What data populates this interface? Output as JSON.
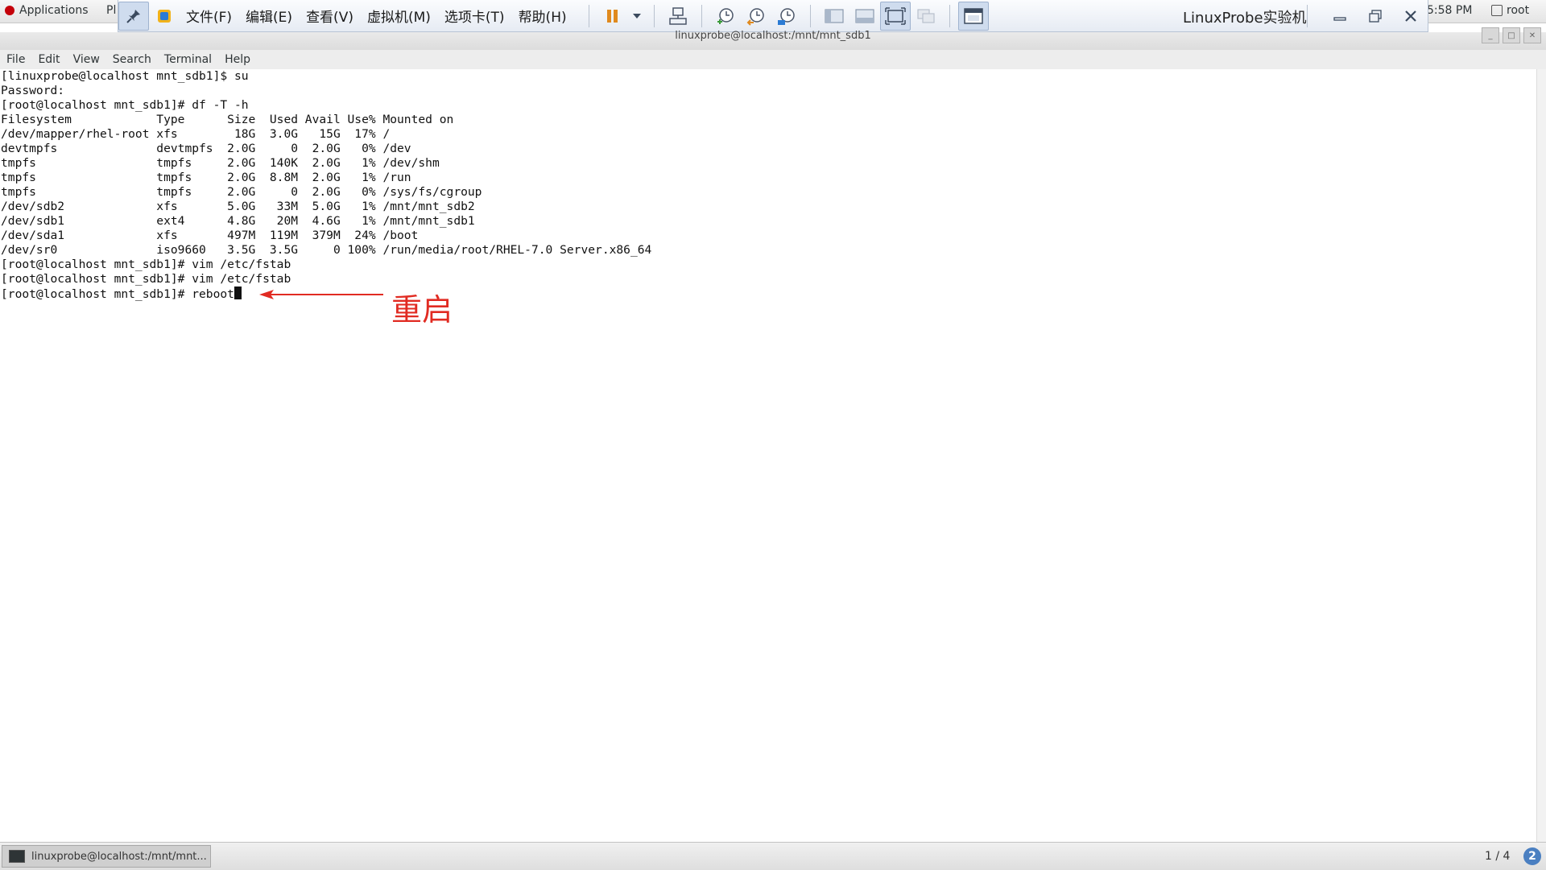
{
  "topbar": {
    "applications": "Applications",
    "places": "Pl",
    "clock": "5:58 PM",
    "user": "root"
  },
  "vmware": {
    "menus": [
      "文件(F)",
      "编辑(E)",
      "查看(V)",
      "虚拟机(M)",
      "选项卡(T)",
      "帮助(H)"
    ],
    "title": "LinuxProbe实验机"
  },
  "terminal": {
    "title": "linuxprobe@localhost:/mnt/mnt_sdb1",
    "menus": [
      "File",
      "Edit",
      "View",
      "Search",
      "Terminal",
      "Help"
    ],
    "lines": [
      "[linuxprobe@localhost mnt_sdb1]$ su",
      "Password:",
      "[root@localhost mnt_sdb1]# df -T -h",
      "Filesystem            Type      Size  Used Avail Use% Mounted on",
      "/dev/mapper/rhel-root xfs        18G  3.0G   15G  17% /",
      "devtmpfs              devtmpfs  2.0G     0  2.0G   0% /dev",
      "tmpfs                 tmpfs     2.0G  140K  2.0G   1% /dev/shm",
      "tmpfs                 tmpfs     2.0G  8.8M  2.0G   1% /run",
      "tmpfs                 tmpfs     2.0G     0  2.0G   0% /sys/fs/cgroup",
      "/dev/sdb2             xfs       5.0G   33M  5.0G   1% /mnt/mnt_sdb2",
      "/dev/sdb1             ext4      4.8G   20M  4.6G   1% /mnt/mnt_sdb1",
      "/dev/sda1             xfs       497M  119M  379M  24% /boot",
      "/dev/sr0              iso9660   3.5G  3.5G     0 100% /run/media/root/RHEL-7.0 Server.x86_64",
      "[root@localhost mnt_sdb1]# vim /etc/fstab",
      "[root@localhost mnt_sdb1]# vim /etc/fstab"
    ],
    "current_line": "[root@localhost mnt_sdb1]# reboot"
  },
  "annotation": {
    "text": "重启",
    "color": "#e12b22"
  },
  "taskbar": {
    "item": "linuxprobe@localhost:/mnt/mnt...",
    "workspace": "1 / 4",
    "help": "2"
  }
}
